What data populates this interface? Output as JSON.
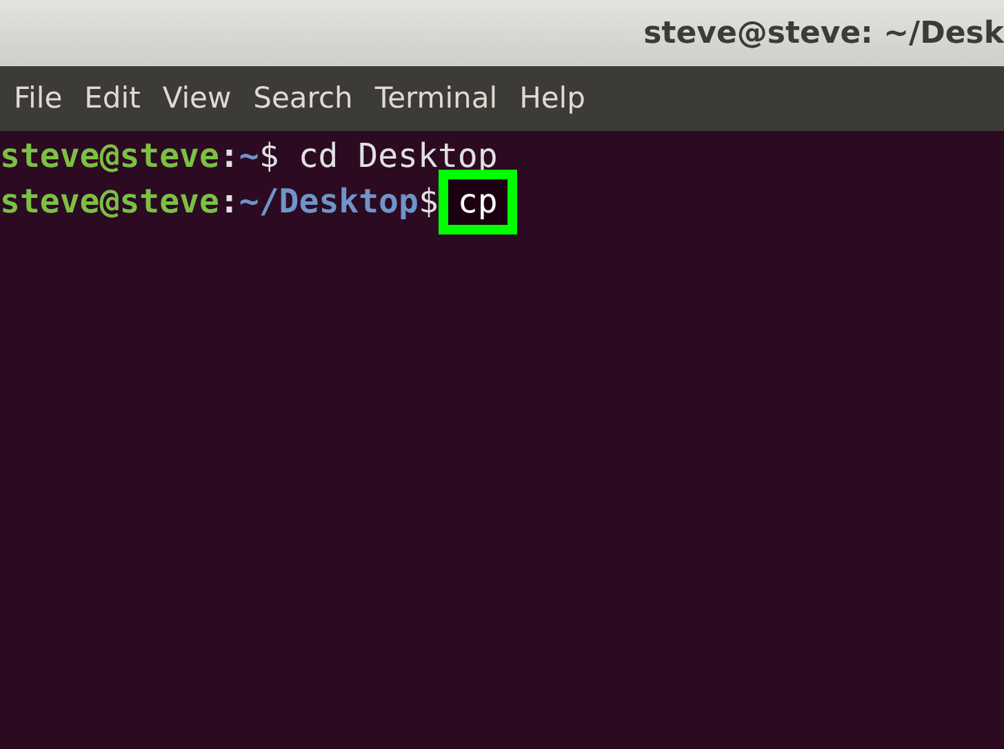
{
  "window": {
    "title": "steve@steve: ~/Desk"
  },
  "menu": [
    "File",
    "Edit",
    "View",
    "Search",
    "Terminal",
    "Help"
  ],
  "lines": [
    {
      "user": "steve@steve",
      "separator": ":",
      "path": "~",
      "prompt": "$",
      "command": "cd Desktop",
      "highlighted": false
    },
    {
      "user": "steve@steve",
      "separator": ":",
      "path": "~/Desktop",
      "prompt": "$",
      "command": "cp",
      "highlighted": true
    }
  ]
}
